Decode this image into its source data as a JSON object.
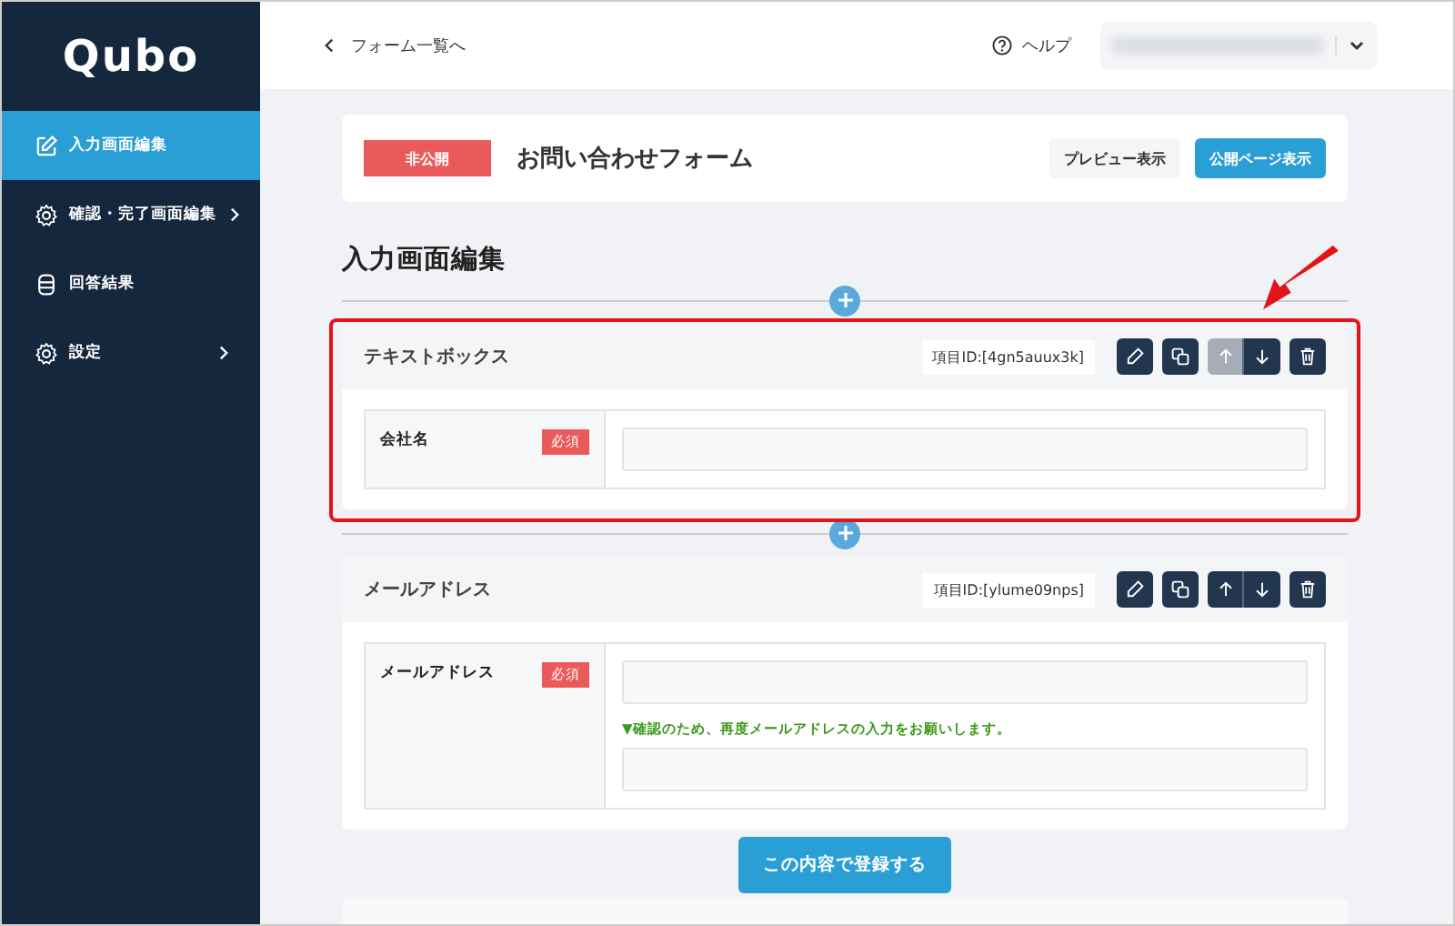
{
  "sidebar": {
    "logo": "Qubo",
    "items": [
      {
        "kind": "edit",
        "label": "入力画面編集",
        "selected": true,
        "has_submenu": false
      },
      {
        "kind": "gear",
        "label": "確認・完了画面編集",
        "selected": false,
        "has_submenu": true
      },
      {
        "kind": "database",
        "label": "回答結果",
        "selected": false,
        "has_submenu": false
      },
      {
        "kind": "gear",
        "label": "設定",
        "selected": false,
        "has_submenu": true
      }
    ]
  },
  "topbar": {
    "back_link": "フォーム一覧へ",
    "help": "ヘルプ"
  },
  "form_header": {
    "status": "非公開",
    "title": "お問い合わせフォーム",
    "buttons": [
      {
        "label": "プレビュー表示",
        "kind": "secondary"
      },
      {
        "label": "公開ページ表示",
        "kind": "primary"
      }
    ]
  },
  "section_title": "入力画面編集",
  "fields": [
    {
      "type_label": "テキストボックス",
      "item_id": "項目ID:[4gn5auux3k]",
      "highlighted": true,
      "up_disabled": true,
      "label": "会社名",
      "required": "必須",
      "inputs": [
        {
          "kind": "input"
        }
      ]
    },
    {
      "type_label": "メールアドレス",
      "item_id": "項目ID:[ylume09nps]",
      "highlighted": false,
      "up_disabled": false,
      "label": "メールアドレス",
      "required": "必須",
      "inputs": [
        {
          "kind": "input"
        },
        {
          "kind": "note",
          "text": "▼確認のため、再度メールアドレスの入力をお願いします。"
        },
        {
          "kind": "input"
        }
      ]
    }
  ],
  "submit": "この内容で登録する"
}
